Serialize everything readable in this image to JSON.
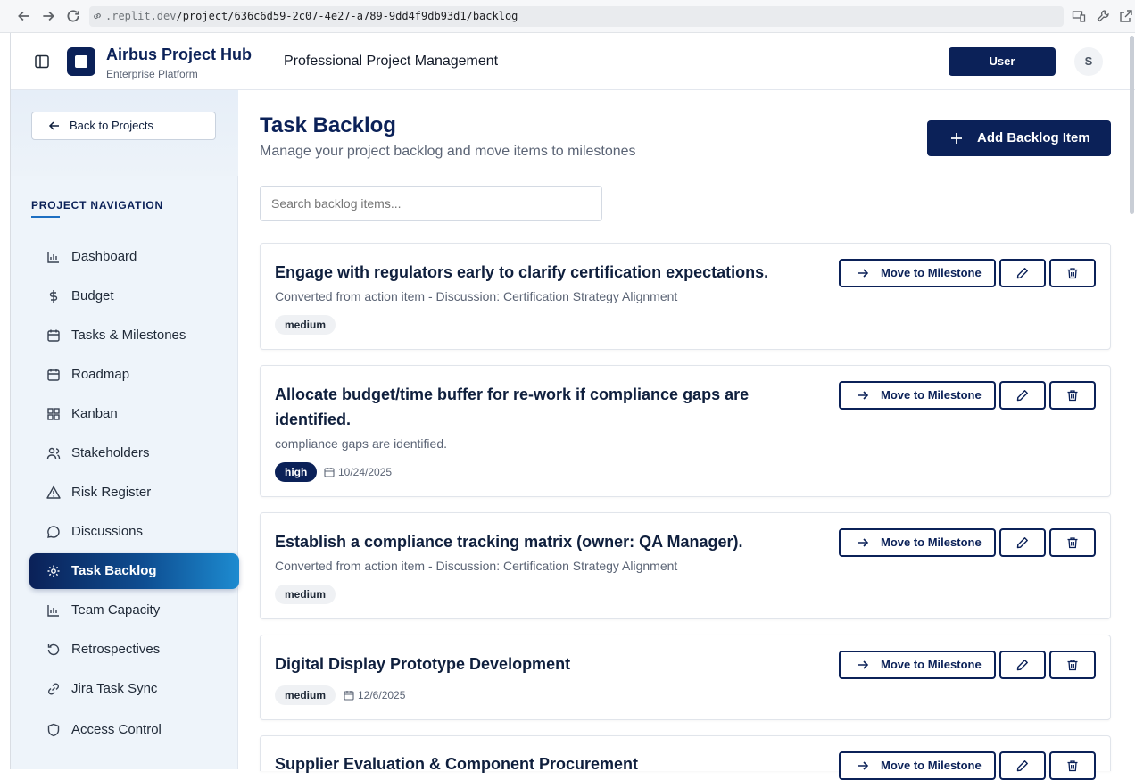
{
  "browser": {
    "url_prefix": ".replit.dev",
    "url_path": "/project/636c6d59-2c07-4e27-a789-9dd4f9db93d1/backlog"
  },
  "header": {
    "brand_title": "Airbus Project Hub",
    "brand_subtitle": "Enterprise Platform",
    "page_heading": "Professional Project Management",
    "user_button": "User",
    "avatar_initial": "S"
  },
  "sidebar": {
    "back_label": "Back to Projects",
    "nav_heading": "PROJECT NAVIGATION",
    "items": [
      {
        "label": "Dashboard",
        "icon": "bar-chart-icon"
      },
      {
        "label": "Budget",
        "icon": "dollar-icon"
      },
      {
        "label": "Tasks & Milestones",
        "icon": "calendar-icon"
      },
      {
        "label": "Roadmap",
        "icon": "calendar-icon"
      },
      {
        "label": "Kanban",
        "icon": "grid-icon"
      },
      {
        "label": "Stakeholders",
        "icon": "users-icon"
      },
      {
        "label": "Risk Register",
        "icon": "warning-icon"
      },
      {
        "label": "Discussions",
        "icon": "chat-icon"
      },
      {
        "label": "Task Backlog",
        "icon": "gear-icon",
        "active": true
      },
      {
        "label": "Team Capacity",
        "icon": "bar-chart-icon"
      },
      {
        "label": "Retrospectives",
        "icon": "rotate-icon"
      },
      {
        "label": "Jira Task Sync",
        "icon": "link-icon"
      },
      {
        "label": "Access Control",
        "icon": "shield-icon"
      }
    ]
  },
  "main": {
    "title": "Task Backlog",
    "subtitle": "Manage your project backlog and move items to milestones",
    "add_button": "Add Backlog Item",
    "search_placeholder": "Search backlog items...",
    "move_label": "Move to Milestone",
    "items": [
      {
        "title": "Engage with regulators early to clarify certification expectations.",
        "description": "Converted from action item - Discussion: Certification Strategy Alignment",
        "priority": "medium",
        "due": ""
      },
      {
        "title": "Allocate budget/time buffer for re-work if compliance gaps are identified.",
        "description": "compliance gaps are identified.",
        "priority": "high",
        "due": "10/24/2025"
      },
      {
        "title": "Establish a compliance tracking matrix (owner: QA Manager).",
        "description": "Converted from action item - Discussion: Certification Strategy Alignment",
        "priority": "medium",
        "due": ""
      },
      {
        "title": "Digital Display Prototype Development",
        "description": "",
        "priority": "medium",
        "due": "12/6/2025"
      },
      {
        "title": "Supplier Evaluation & Component Procurement",
        "description": "",
        "priority": "",
        "due": ""
      }
    ]
  }
}
